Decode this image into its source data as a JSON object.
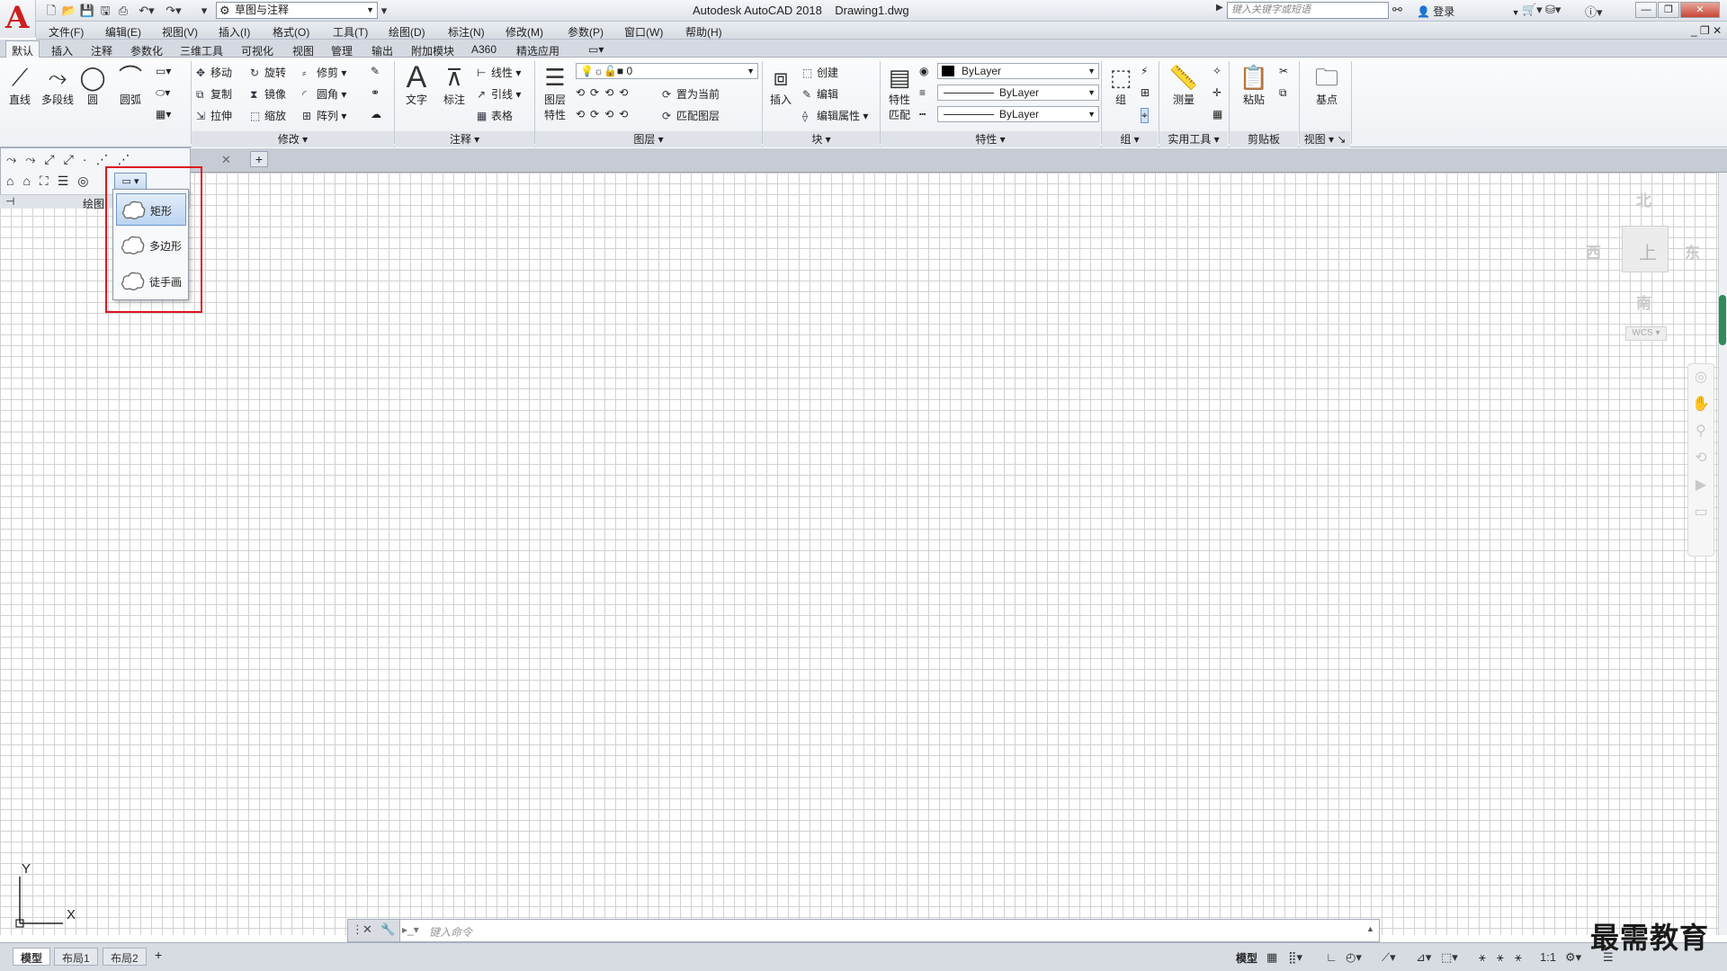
{
  "title": {
    "app": "Autodesk AutoCAD 2018",
    "file": "Drawing1.dwg",
    "workspace": "草图与注释",
    "search_placeholder": "键入关键字或短语",
    "login": "登录"
  },
  "menu": [
    "文件(F)",
    "编辑(E)",
    "视图(V)",
    "插入(I)",
    "格式(O)",
    "工具(T)",
    "绘图(D)",
    "标注(N)",
    "修改(M)",
    "参数(P)",
    "窗口(W)",
    "帮助(H)"
  ],
  "ribbon_tabs": [
    "默认",
    "插入",
    "注释",
    "参数化",
    "三维工具",
    "可视化",
    "视图",
    "管理",
    "输出",
    "附加模块",
    "A360",
    "精选应用"
  ],
  "draw_panel": {
    "line": "直线",
    "polyline": "多段线",
    "circle": "圆",
    "arc": "圆弧",
    "title": "绘图"
  },
  "modify_panel": {
    "move": "移动",
    "rotate": "旋转",
    "trim": "修剪",
    "copy": "复制",
    "mirror": "镜像",
    "fillet": "圆角",
    "stretch": "拉伸",
    "scale": "缩放",
    "array": "阵列",
    "title": "修改"
  },
  "annotation_panel": {
    "text": "文字",
    "dimension": "标注",
    "linear": "线性",
    "leader": "引线",
    "table": "表格",
    "title": "注释"
  },
  "layers_panel": {
    "layer_props_1": "图层",
    "layer_props_2": "特性",
    "current_layer": "0",
    "set_current": "置为当前",
    "match_layer": "匹配图层",
    "title": "图层"
  },
  "block_panel": {
    "insert": "插入",
    "create": "创建",
    "edit": "编辑",
    "edit_attr": "编辑属性",
    "title": "块"
  },
  "properties_panel": {
    "match_1": "特性",
    "match_2": "匹配",
    "color": "ByLayer",
    "linetype": "ByLayer",
    "lineweight": "ByLayer",
    "title": "特性"
  },
  "groups_panel": {
    "group": "组",
    "title": "组"
  },
  "utilities_panel": {
    "measure": "测量",
    "title": "实用工具"
  },
  "clipboard_panel": {
    "paste": "粘贴",
    "title": "剪贴板"
  },
  "view_panel": {
    "base": "基点",
    "title": "视图"
  },
  "cloud_menu": {
    "items": [
      "矩形",
      "多边形",
      "徒手画"
    ],
    "selected": 0
  },
  "viewcube": {
    "north": "北",
    "south": "南",
    "east": "东",
    "west": "西",
    "face": "上",
    "wcs": "WCS"
  },
  "ucs": {
    "x": "X",
    "y": "Y"
  },
  "command_line": {
    "placeholder": "键入命令"
  },
  "layout_tabs": [
    "模型",
    "布局1",
    "布局2"
  ],
  "status": {
    "model": "模型",
    "scale": "1:1"
  },
  "watermark": "最需教育"
}
